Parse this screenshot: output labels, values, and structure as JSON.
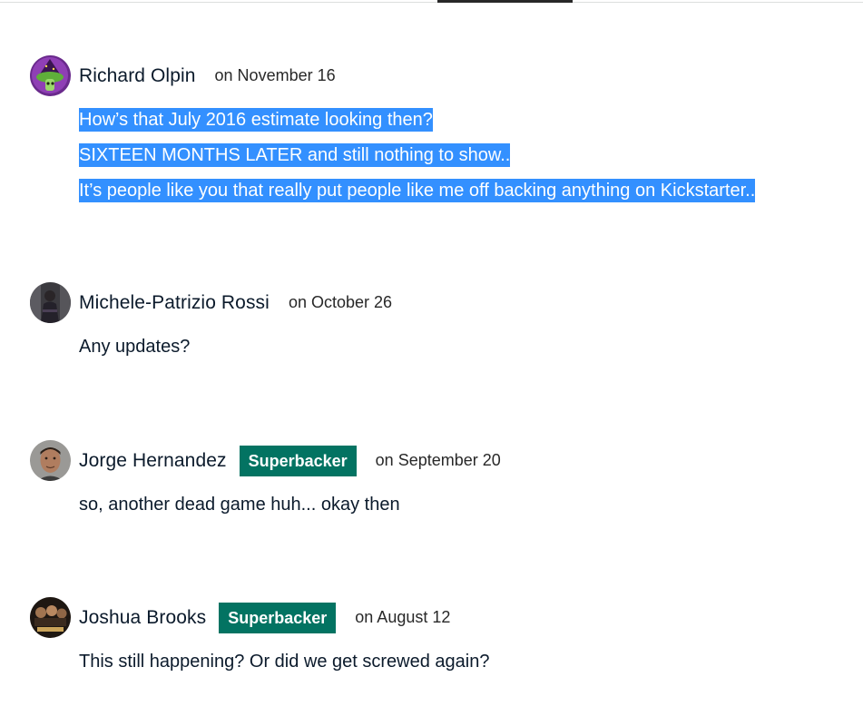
{
  "comments": [
    {
      "author": "Richard Olpin",
      "badge": "",
      "date": "on November 16",
      "paragraphs": [
        "How’s that July 2016 estimate looking then?",
        "SIXTEEN MONTHS LATER and still nothing to show..",
        "It’s people like you that really put people like me off backing anything on Kickstarter.."
      ],
      "selected": true,
      "avatar_icon": "wizard-mushroom-avatar"
    },
    {
      "author": "Michele-Patrizio Rossi",
      "badge": "",
      "date": "on October 26",
      "paragraphs": [
        "Any updates?"
      ],
      "selected": false,
      "avatar_icon": "dark-photo-avatar"
    },
    {
      "author": "Jorge Hernandez",
      "badge": "Superbacker",
      "date": "on September 20",
      "paragraphs": [
        "so, another dead game huh... okay then"
      ],
      "selected": false,
      "avatar_icon": "face-photo-avatar"
    },
    {
      "author": "Joshua Brooks",
      "badge": "Superbacker",
      "date": "on August 12",
      "paragraphs": [
        "This still happening? Or did we get screwed again?"
      ],
      "selected": false,
      "avatar_icon": "poster-avatar"
    }
  ],
  "colors": {
    "badge_bg": "#037362",
    "selection_bg": "#3390ff",
    "text": "#0b1a2b"
  }
}
